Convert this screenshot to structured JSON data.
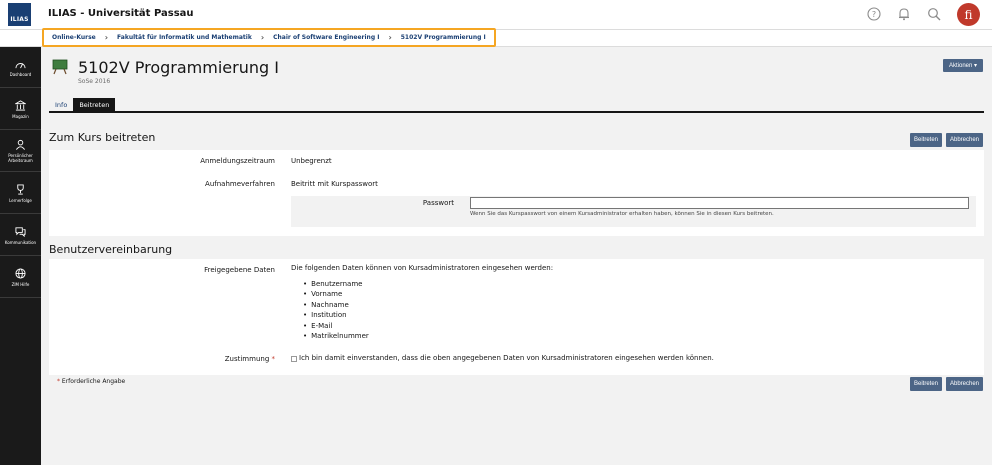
{
  "header": {
    "logo_text": "ILIAS",
    "title": "ILIAS - Universität Passau",
    "avatar_letter": "fi"
  },
  "breadcrumb": [
    "Online-Kurse",
    "Fakultät für Informatik und Mathematik",
    "Chair of Software Engineering I",
    "5102V Programmierung I"
  ],
  "mainbar": [
    "Dashboard",
    "Magazin",
    "Persönlicher Arbeitsraum",
    "Lernerfolge",
    "Kommunikation",
    "ZIM Hilfe"
  ],
  "page": {
    "title": "5102V Programmierung I",
    "subtitle": "SoSe 2016",
    "actions_label": "Aktionen ▾"
  },
  "tabs": [
    {
      "label": "Info",
      "active": false
    },
    {
      "label": "Beitreten",
      "active": true
    }
  ],
  "join": {
    "section_title": "Zum Kurs beitreten",
    "join_label": "Beitreten",
    "cancel_label": "Abbrechen",
    "period_label": "Anmeldungszeitraum",
    "period_value": "Unbegrenzt",
    "procedure_label": "Aufnahmeverfahren",
    "procedure_value": "Beitritt mit Kurspasswort",
    "password_label": "Passwort",
    "password_value": "",
    "password_hint": "Wenn Sie das Kurspasswort von einem Kursadministrator erhalten haben, können Sie in diesen Kurs beitreten."
  },
  "agreement": {
    "section_title": "Benutzervereinbarung",
    "data_label": "Freigegebene Daten",
    "data_intro": "Die folgenden Daten können von Kursadministratoren eingesehen werden:",
    "data_items": [
      "Benutzername",
      "Vorname",
      "Nachname",
      "Institution",
      "E-Mail",
      "Matrikelnummer"
    ],
    "consent_label": "Zustimmung",
    "consent_text": "Ich bin damit einverstanden, dass die oben angegebenen Daten von Kursadministratoren eingesehen werden können.",
    "required_star": "*",
    "required_note": "Erforderliche Angabe",
    "join_label": "Beitreten",
    "cancel_label": "Abbrechen"
  },
  "colors": {
    "primary_button": "#4c6586",
    "highlight": "#f5a623",
    "mainbar": "#1a1a1a",
    "link": "#1a3f73"
  }
}
